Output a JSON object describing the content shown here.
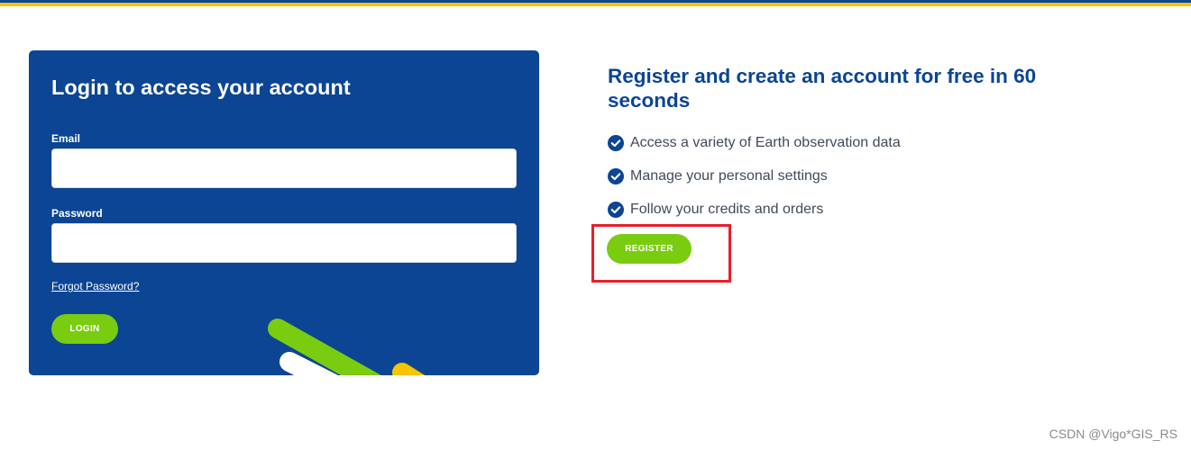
{
  "login": {
    "title": "Login to access your account",
    "email_label": "Email",
    "email_value": "",
    "password_label": "Password",
    "password_value": "",
    "forgot_password": "Forgot Password?",
    "login_button": "LOGIN"
  },
  "register": {
    "title": "Register and create an account for free in 60 seconds",
    "benefits": [
      "Access a variety of Earth observation data",
      "Manage your personal settings",
      "Follow your credits and orders"
    ],
    "register_button": "REGISTER"
  },
  "watermark": "CSDN @Vigo*GIS_RS",
  "colors": {
    "brand_blue": "#0b4594",
    "accent_green": "#7acc10",
    "accent_yellow": "#f5c400",
    "highlight_red": "#e5202a"
  },
  "icons": {
    "benefit_icon": "check-circle-icon"
  }
}
